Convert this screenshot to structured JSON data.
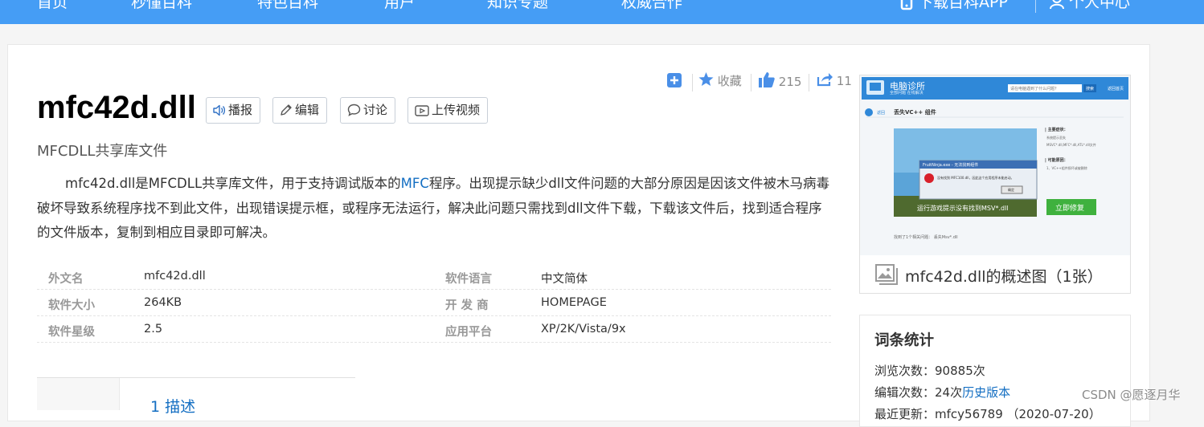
{
  "nav": {
    "items": [
      "首页",
      "秒懂百科",
      "特色百科",
      "用户",
      "知识专题",
      "权威合作"
    ],
    "download_app": "下载百科APP",
    "personal_center": "个人中心"
  },
  "entry": {
    "title": "mfc42d.dll",
    "subtitle": "MFCDLL共享库文件",
    "buttons": {
      "broadcast": "播报",
      "edit": "编辑",
      "discuss": "讨论",
      "upload_video": "上传视频"
    },
    "stats": {
      "favorite": "收藏",
      "likes": "215",
      "shares": "11"
    },
    "description": {
      "before_link": "mfc42d.dll是MFCDLL共享库文件，用于支持调试版本的",
      "link": "MFC",
      "after_link": "程序。出现提示缺少dll文件问题的大部分原因是因该文件被木马病毒破坏导致系统程序找不到此文件，出现错误提示框，或程序无法运行，解决此问题只需找到dll文件下载，下载该文件后，找到适合程序的文件版本，复制到相应目录即可解决。"
    },
    "info": [
      {
        "label_l": "外文名",
        "value_l": "mfc42d.dll",
        "label_r": "软件语言",
        "value_r": "中文简体"
      },
      {
        "label_l": "软件大小",
        "value_l": "264KB",
        "label_r": "开 发 商",
        "value_r": "HOMEPAGE"
      },
      {
        "label_l": "软件星级",
        "value_l": "2.5",
        "label_r": "应用平台",
        "value_r": "XP/2K/Vista/9x"
      }
    ],
    "catalog_first": "1   描述"
  },
  "sidebar": {
    "summary_caption": "mfc42d.dll的概述图（1张）",
    "screenshot": {
      "app_name": "电脑诊所",
      "app_sub": "全部问题 在线解决",
      "search_placeholder": "请在电脑遇到了什么问题？",
      "search_btn": "搜索",
      "header_right": "返回首页",
      "back": "返回",
      "page_heading": "丢失VC++ 组件",
      "dialog_title": "FruitNinja.exe - 无法找到组件",
      "dialog_msg": "没有找到 MFC100.dll，因此这个应用程序未能启动。",
      "dialog_ok": "确定",
      "img_caption": "运行游戏提示没有找到MSV*.dll",
      "symptom_title": "| 主要症状：",
      "symptom_1": "系统提示丢失",
      "symptom_2": "MSVC*.dll,MFC*.dll,ATL*.dll文件",
      "cause_title": "| 可能原因：",
      "cause_1": "1、VC++组件损坏或被删除",
      "fix_btn": "立即修复",
      "bottom_note": "找到了1个相关问题：  丢失Msv*.dll"
    },
    "stats_title": "词条统计",
    "views_label": "浏览次数：",
    "views_value": "90885次",
    "edits_label": "编辑次数：",
    "edits_value": "24次",
    "history_link": "历史版本",
    "last_update_label": "最近更新：",
    "last_update_value": "mfcy56789  （2020-07-20）"
  },
  "watermark": "CSDN @愿逐月华",
  "colors": {
    "nav_bg": "#459df5",
    "link": "#136ec2",
    "fix_button": "#3fb13e",
    "label_gray": "#999999"
  }
}
